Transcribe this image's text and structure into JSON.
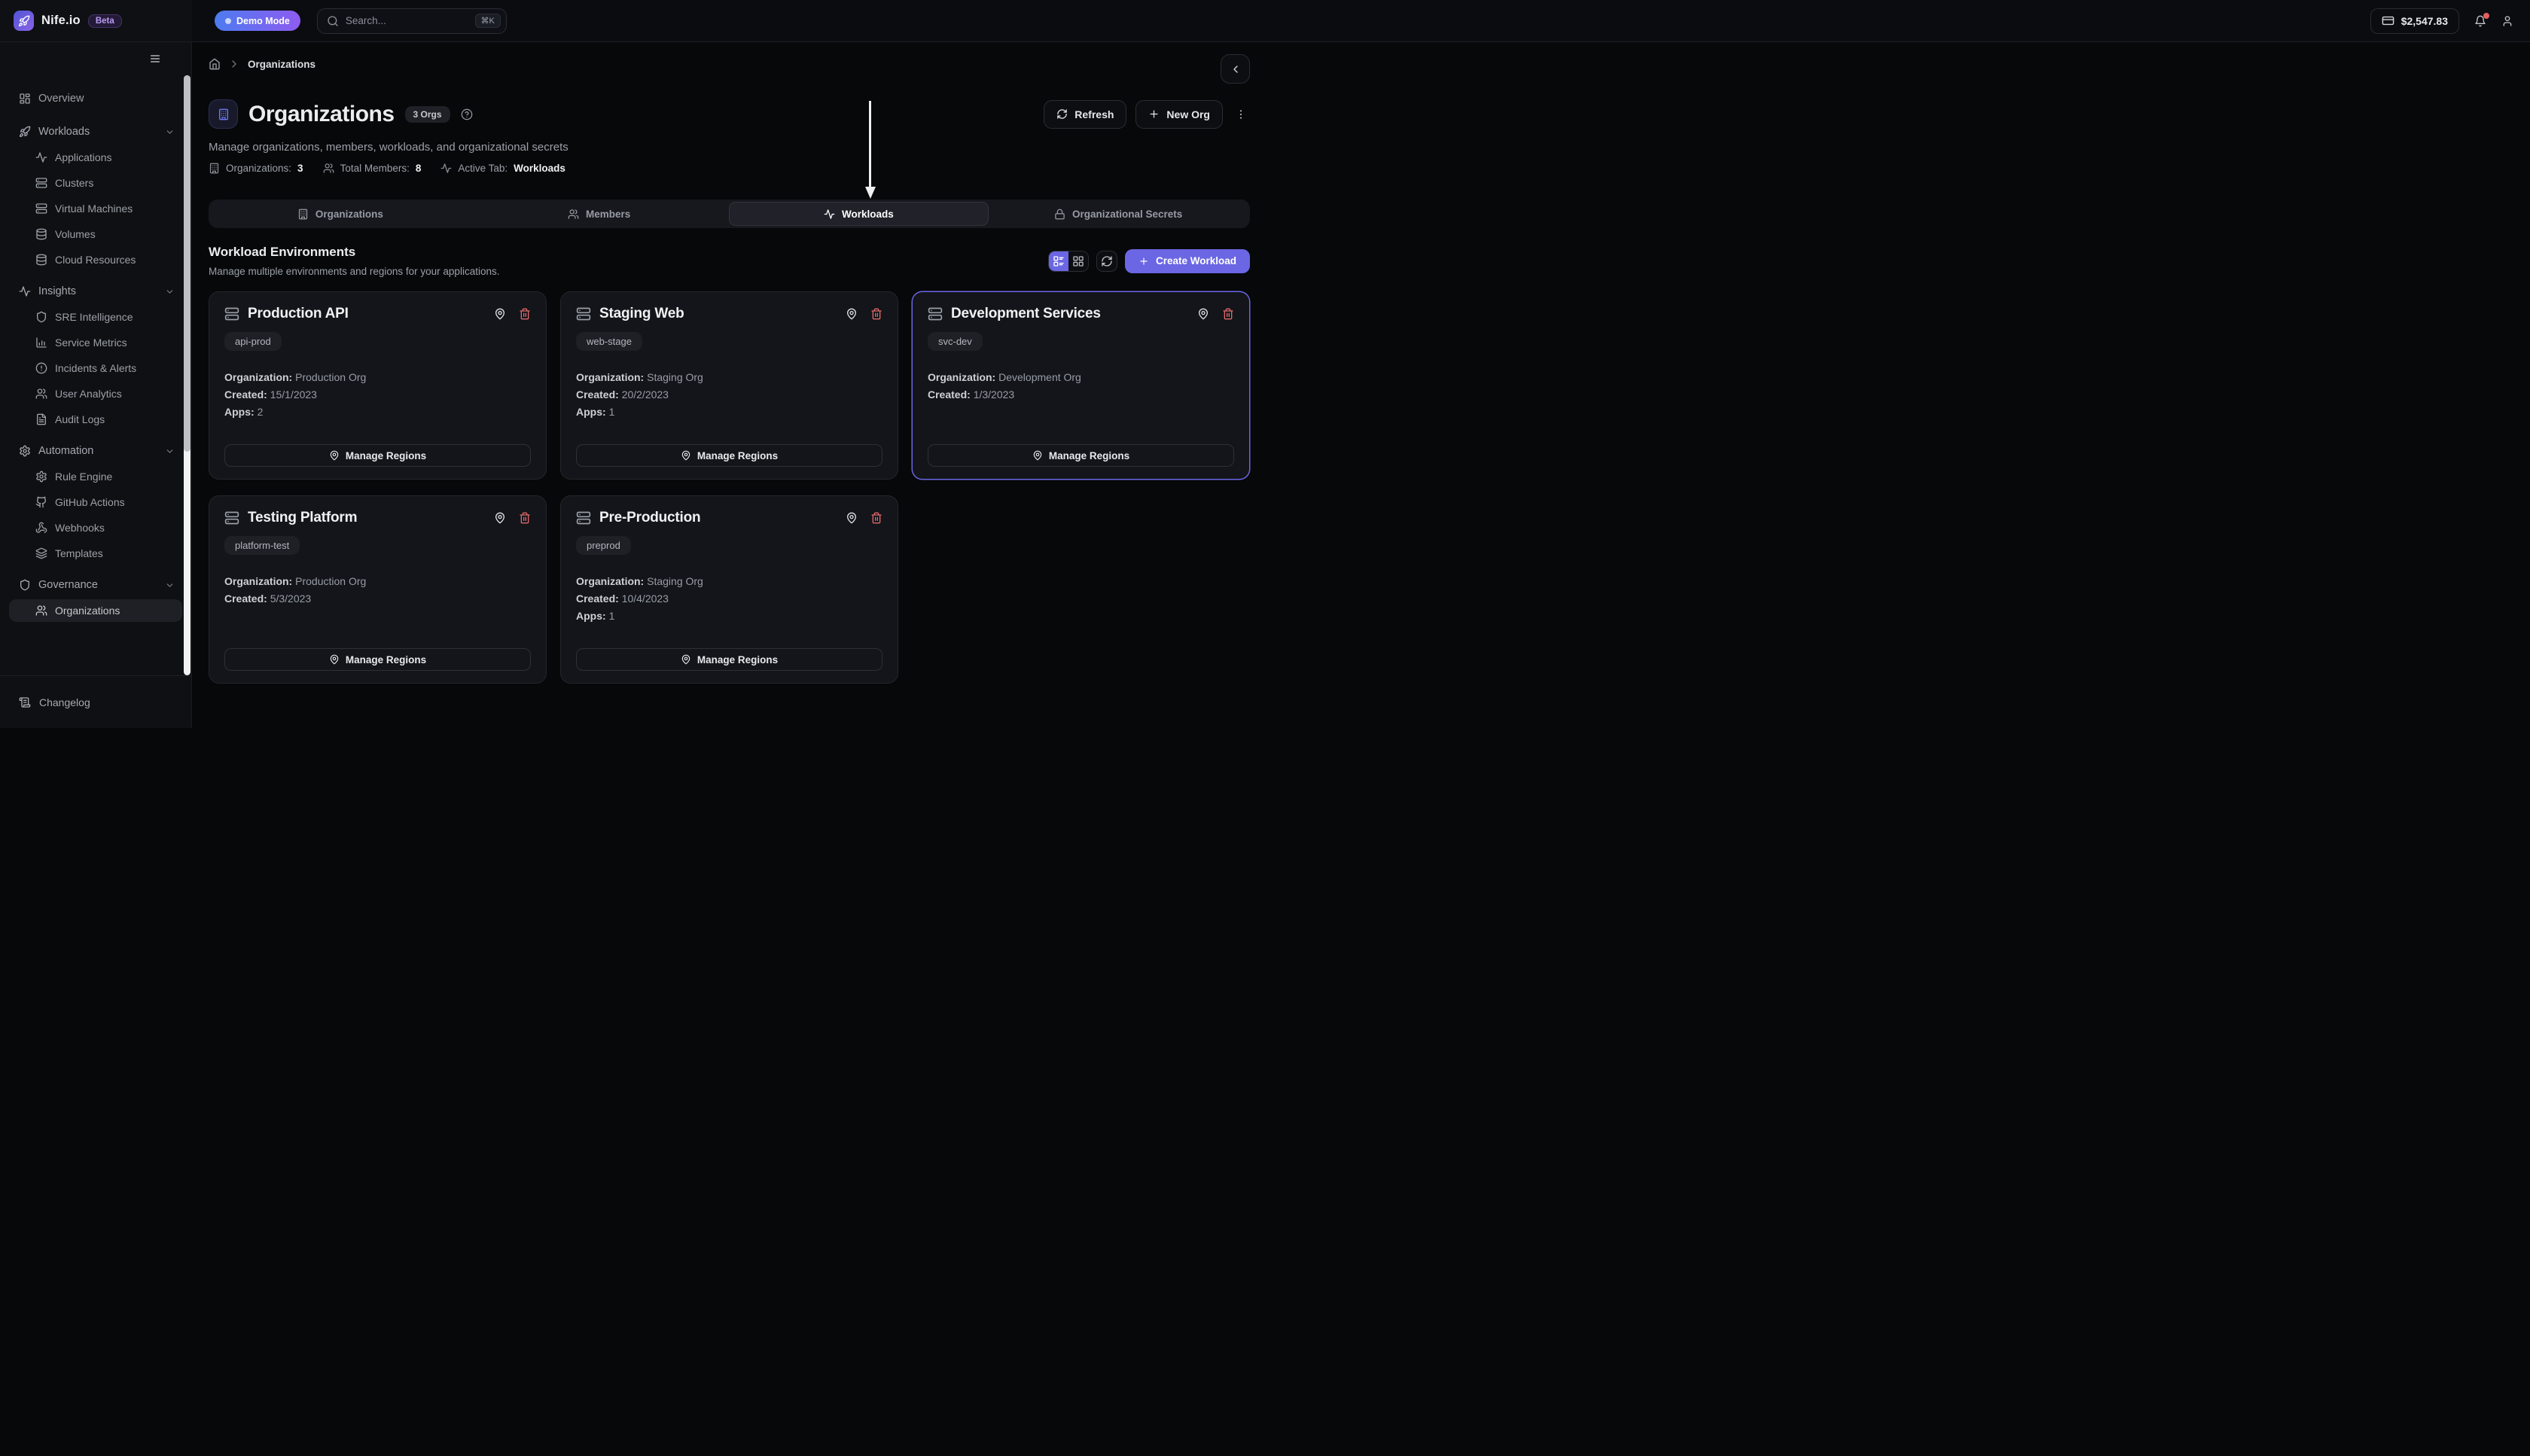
{
  "topbar": {
    "brand": "Nife.io",
    "beta_badge": "Beta",
    "demo_badge": "Demo Mode",
    "search_placeholder": "Search...",
    "search_shortcut": "⌘K",
    "balance": "$2,547.83"
  },
  "sidebar": {
    "items": [
      {
        "label": "Overview",
        "icon": "grid",
        "type": "top"
      },
      {
        "label": "Workloads",
        "icon": "rocket",
        "type": "section",
        "chevron": true
      },
      {
        "label": "Applications",
        "icon": "activity",
        "type": "sub"
      },
      {
        "label": "Clusters",
        "icon": "server",
        "type": "sub"
      },
      {
        "label": "Virtual Machines",
        "icon": "server",
        "type": "sub"
      },
      {
        "label": "Volumes",
        "icon": "database",
        "type": "sub"
      },
      {
        "label": "Cloud Resources",
        "icon": "database",
        "type": "sub"
      },
      {
        "label": "Insights",
        "icon": "activity",
        "type": "section",
        "chevron": true
      },
      {
        "label": "SRE Intelligence",
        "icon": "shield",
        "type": "sub"
      },
      {
        "label": "Service Metrics",
        "icon": "bar-chart",
        "type": "sub"
      },
      {
        "label": "Incidents & Alerts",
        "icon": "alert-circle",
        "type": "sub"
      },
      {
        "label": "User Analytics",
        "icon": "users",
        "type": "sub"
      },
      {
        "label": "Audit Logs",
        "icon": "file-text",
        "type": "sub"
      },
      {
        "label": "Automation",
        "icon": "gear",
        "type": "section",
        "chevron": true
      },
      {
        "label": "Rule Engine",
        "icon": "gear",
        "type": "sub"
      },
      {
        "label": "GitHub Actions",
        "icon": "github",
        "type": "sub"
      },
      {
        "label": "Webhooks",
        "icon": "webhook",
        "type": "sub"
      },
      {
        "label": "Templates",
        "icon": "layers",
        "type": "sub"
      },
      {
        "label": "Governance",
        "icon": "shield",
        "type": "section",
        "chevron": true
      },
      {
        "label": "Organizations",
        "icon": "users",
        "type": "sub",
        "active": true
      }
    ],
    "bottom_item": {
      "label": "Changelog",
      "icon": "scroll"
    }
  },
  "breadcrumb": {
    "page": "Organizations"
  },
  "header": {
    "title": "Organizations",
    "count_badge": "3 Orgs",
    "subtitle": "Manage organizations, members, workloads, and organizational secrets",
    "stats": [
      {
        "icon": "building",
        "label": "Organizations:",
        "value": "3"
      },
      {
        "icon": "users",
        "label": "Total Members:",
        "value": "8"
      },
      {
        "icon": "activity",
        "label": "Active Tab:",
        "value": "Workloads"
      }
    ],
    "refresh_label": "Refresh",
    "new_org_label": "New Org"
  },
  "tabs": [
    {
      "label": "Organizations",
      "icon": "building"
    },
    {
      "label": "Members",
      "icon": "users"
    },
    {
      "label": "Workloads",
      "icon": "activity",
      "active": true
    },
    {
      "label": "Organizational Secrets",
      "icon": "lock"
    }
  ],
  "workloads_section": {
    "title": "Workload Environments",
    "subtitle": "Manage multiple environments and regions for your applications.",
    "create_label": "Create Workload",
    "manage_label": "Manage Regions"
  },
  "labels": {
    "organization": "Organization:",
    "created": "Created:",
    "apps": "Apps:"
  },
  "cards": [
    {
      "name": "Production API",
      "tag": "api-prod",
      "org": "Production Org",
      "created": "15/1/2023",
      "apps": "2"
    },
    {
      "name": "Staging Web",
      "tag": "web-stage",
      "org": "Staging Org",
      "created": "20/2/2023",
      "apps": "1"
    },
    {
      "name": "Development Services",
      "tag": "svc-dev",
      "org": "Development Org",
      "created": "1/3/2023",
      "highlighted": true
    },
    {
      "name": "Testing Platform",
      "tag": "platform-test",
      "org": "Production Org",
      "created": "5/3/2023"
    },
    {
      "name": "Pre-Production",
      "tag": "preprod",
      "org": "Staging Org",
      "created": "10/4/2023",
      "apps": "1"
    }
  ],
  "colors": {
    "accent": "#6b66e3",
    "danger": "#e0696b",
    "demo_gradient_start": "#4d7bf0",
    "demo_gradient_end": "#8e5cf0"
  }
}
